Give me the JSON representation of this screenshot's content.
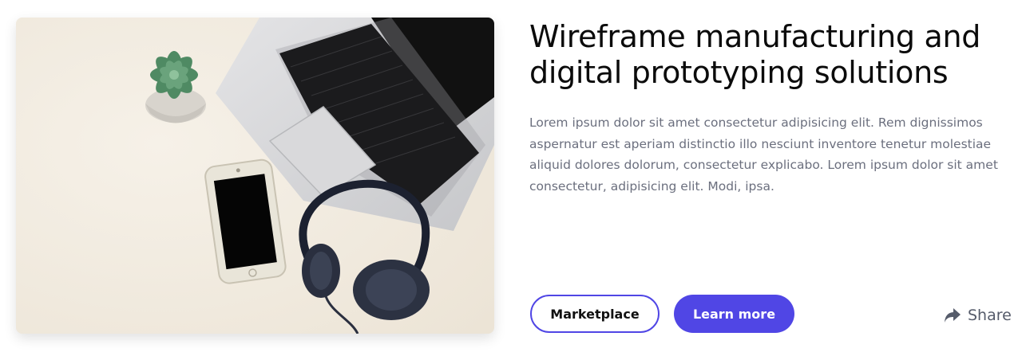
{
  "card": {
    "image_alt": "Laptop, smartphone, headphones and succulent on a desk",
    "title": "Wireframe manufacturing and digital prototyping solutions",
    "description": "Lorem ipsum dolor sit amet consectetur adipisicing elit. Rem dignissimos aspernatur est aperiam distinctio illo nesciunt inventore tenetur molestiae aliquid dolores dolorum, consectetur explicabo. Lorem ipsum dolor sit amet consectetur, adipisicing elit. Modi, ipsa.",
    "buttons": {
      "marketplace_label": "Marketplace",
      "learn_more_label": "Learn more"
    },
    "share": {
      "label": "Share",
      "icon": "share-icon"
    }
  },
  "colors": {
    "accent": "#5046e5",
    "text_dark": "#0b0b0b",
    "text_muted": "#6b6f7e"
  }
}
